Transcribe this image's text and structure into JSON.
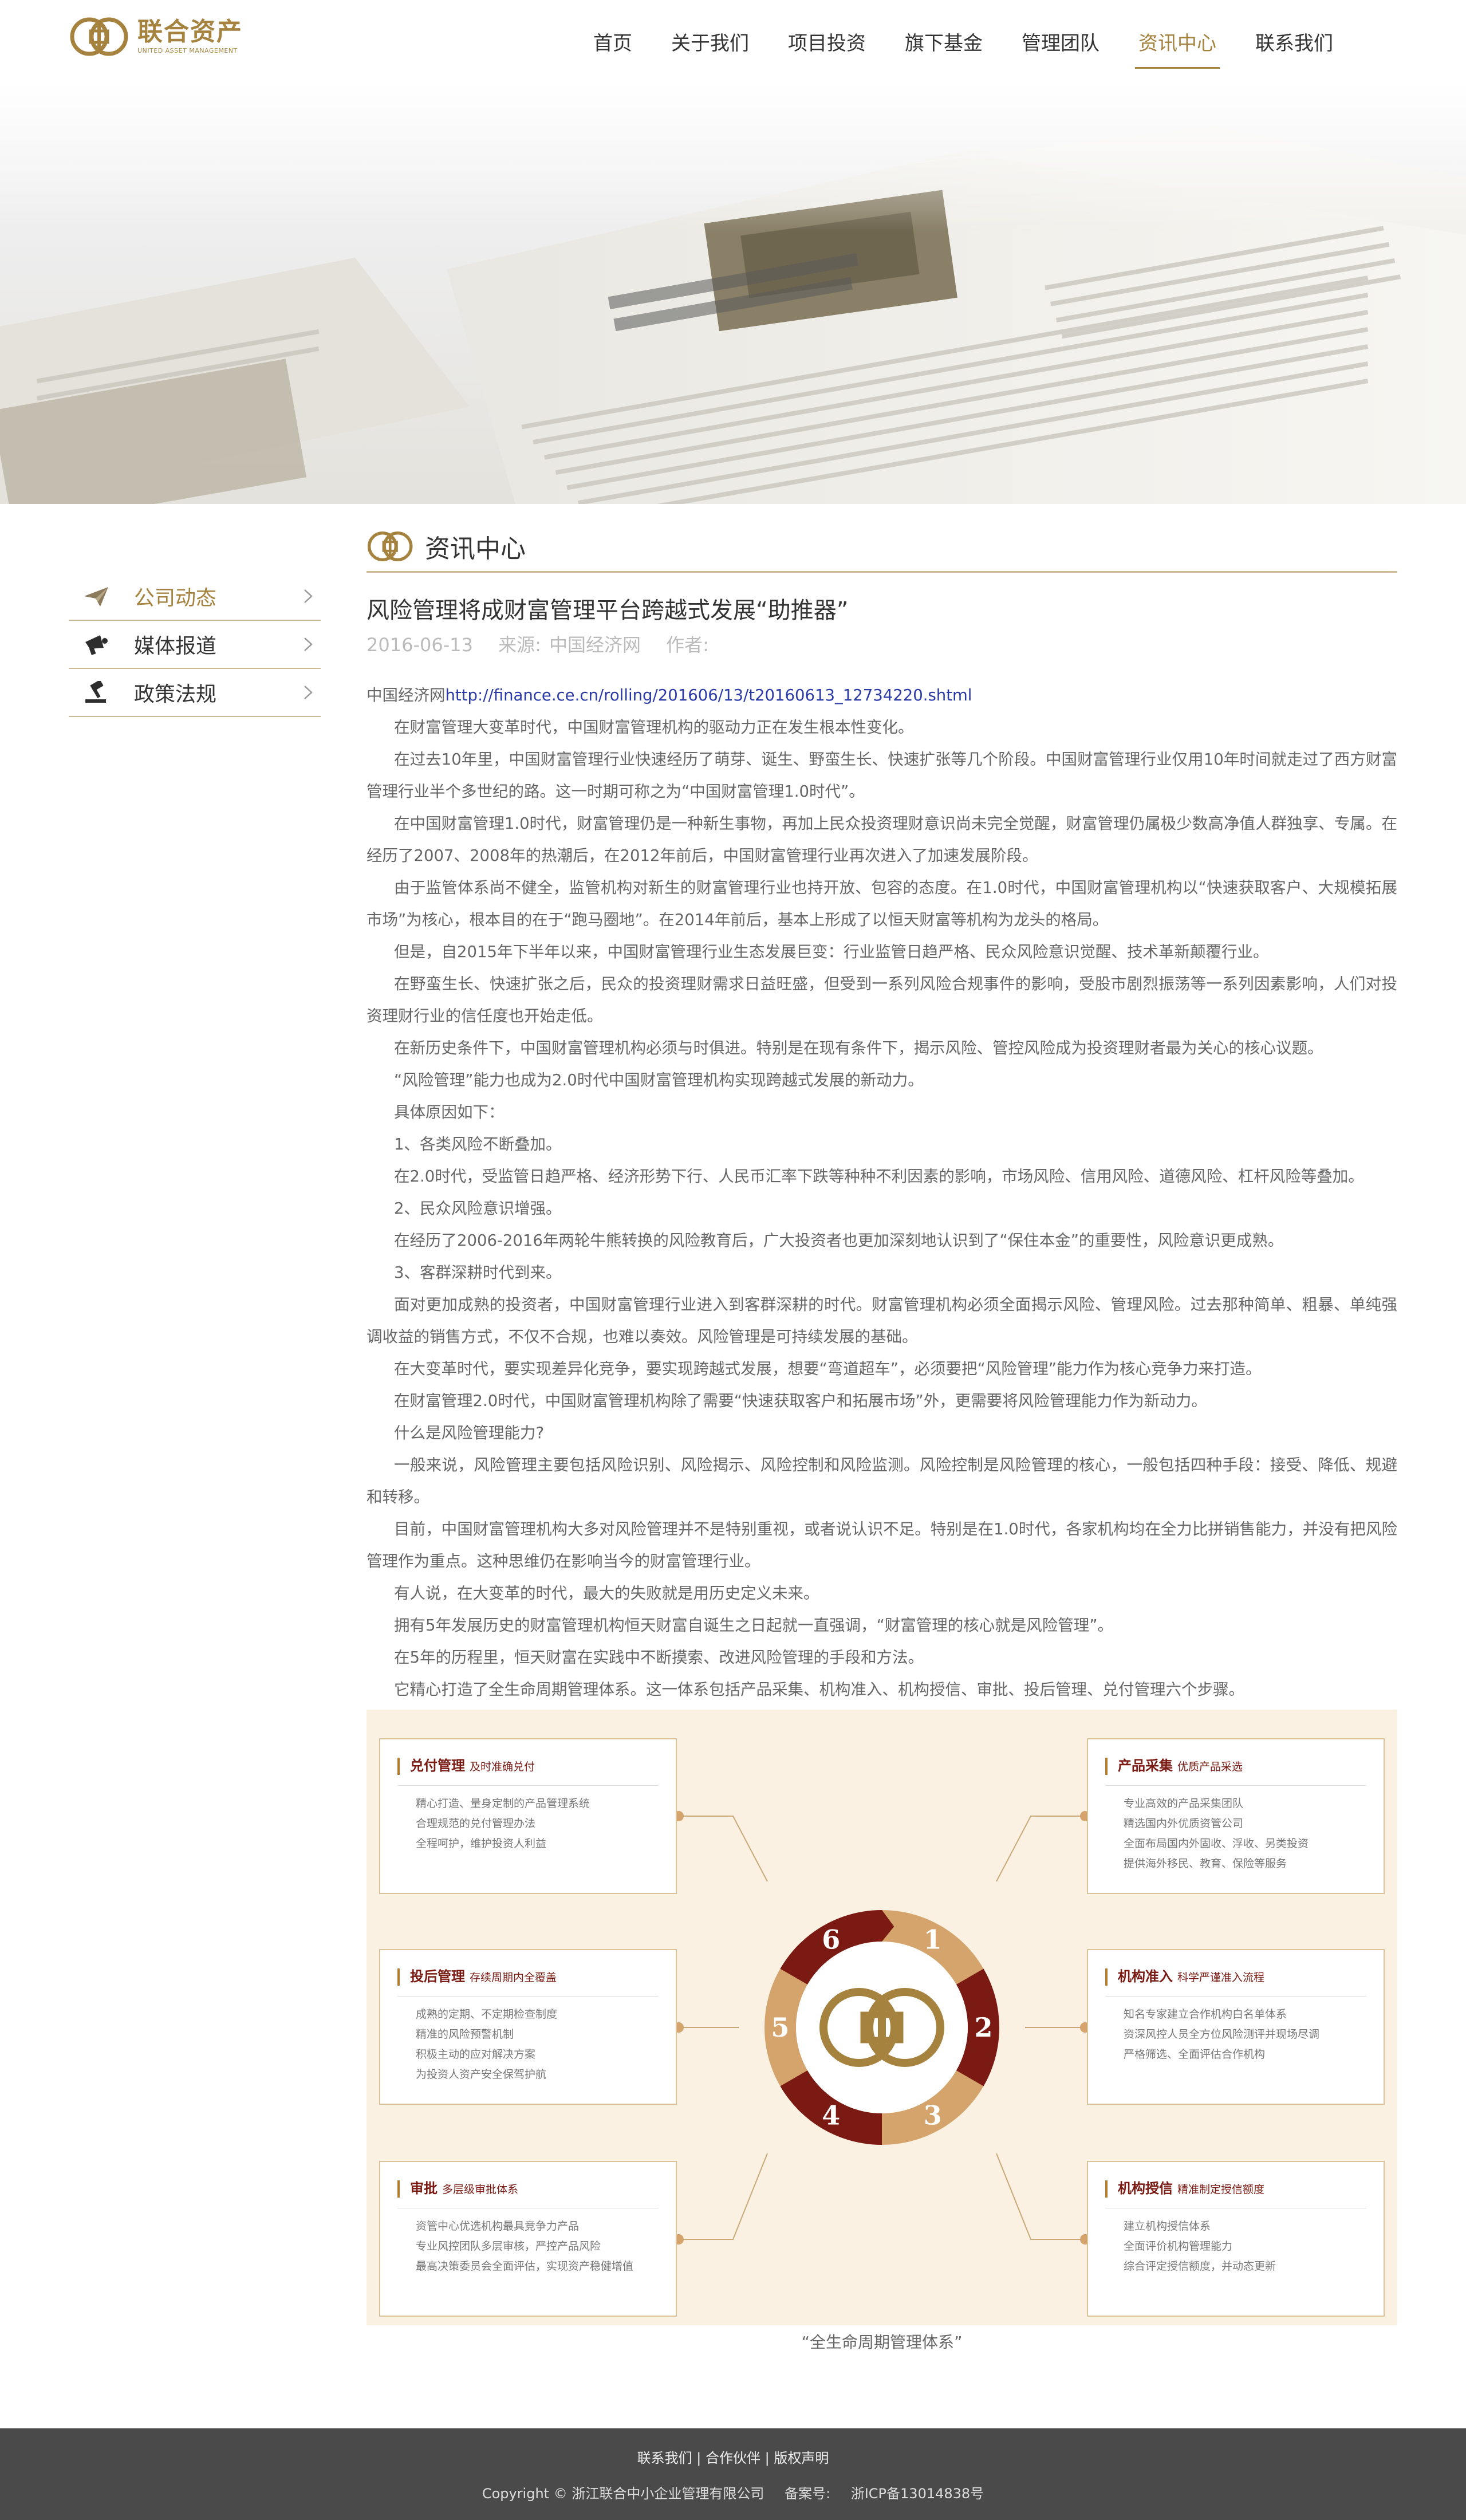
{
  "brand": {
    "name_cn": "联合资产",
    "name_en": "UNITED ASSET MANAGEMENT"
  },
  "nav": [
    {
      "label": "首页"
    },
    {
      "label": "关于我们"
    },
    {
      "label": "项目投资"
    },
    {
      "label": "旗下基金"
    },
    {
      "label": "管理团队"
    },
    {
      "label": "资讯中心"
    },
    {
      "label": "联系我们"
    }
  ],
  "nav_active": "资讯中心",
  "sidebar": {
    "items": [
      {
        "label": "公司动态",
        "icon": "paper-plane-icon",
        "active": true
      },
      {
        "label": "媒体报道",
        "icon": "megaphone-icon",
        "active": false
      },
      {
        "label": "政策法规",
        "icon": "gavel-icon",
        "active": false
      }
    ]
  },
  "section": {
    "title": "资讯中心"
  },
  "article": {
    "title": "风险管理将成财富管理平台跨越式发展“助推器”",
    "date": "2016-06-13",
    "source_label": "来源:",
    "source": "中国经济网",
    "author_label": "作者:",
    "source_prefix": "中国经济网",
    "source_url": "http://finance.ce.cn/rolling/201606/13/t20160613_12734220.shtml",
    "paragraphs": [
      "在财富管理大变革时代，中国财富管理机构的驱动力正在发生根本性变化。",
      "在过去10年里，中国财富管理行业快速经历了萌芽、诞生、野蛮生长、快速扩张等几个阶段。中国财富管理行业仅用10年时间就走过了西方财富管理行业半个多世纪的路。这一时期可称之为“中国财富管理1.0时代”。",
      "在中国财富管理1.0时代，财富管理仍是一种新生事物，再加上民众投资理财意识尚未完全觉醒，财富管理仍属极少数高净值人群独享、专属。在经历了2007、2008年的热潮后，在2012年前后，中国财富管理行业再次进入了加速发展阶段。",
      "由于监管体系尚不健全，监管机构对新生的财富管理行业也持开放、包容的态度。在1.0时代，中国财富管理机构以“快速获取客户、大规模拓展市场”为核心，根本目的在于“跑马圈地”。在2014年前后，基本上形成了以恒天财富等机构为龙头的格局。",
      "但是，自2015年下半年以来，中国财富管理行业生态发展巨变：行业监管日趋严格、民众风险意识觉醒、技术革新颠覆行业。",
      "在野蛮生长、快速扩张之后，民众的投资理财需求日益旺盛，但受到一系列风险合规事件的影响，受股市剧烈振荡等一系列因素影响，人们对投资理财行业的信任度也开始走低。",
      "在新历史条件下，中国财富管理机构必须与时俱进。特别是在现有条件下，揭示风险、管控风险成为投资理财者最为关心的核心议题。",
      "“风险管理”能力也成为2.0时代中国财富管理机构实现跨越式发展的新动力。",
      "具体原因如下：",
      "1、各类风险不断叠加。",
      "在2.0时代，受监管日趋严格、经济形势下行、人民币汇率下跌等种种不利因素的影响，市场风险、信用风险、道德风险、杠杆风险等叠加。",
      "2、民众风险意识增强。",
      "在经历了2006-2016年两轮牛熊转换的风险教育后，广大投资者也更加深刻地认识到了“保住本金”的重要性，风险意识更成熟。",
      "3、客群深耕时代到来。",
      "面对更加成熟的投资者，中国财富管理行业进入到客群深耕的时代。财富管理机构必须全面揭示风险、管理风险。过去那种简单、粗暴、单纯强调收益的销售方式，不仅不合规，也难以奏效。风险管理是可持续发展的基础。",
      "在大变革时代，要实现差异化竞争，要实现跨越式发展，想要“弯道超车”，必须要把“风险管理”能力作为核心竞争力来打造。",
      "在财富管理2.0时代，中国财富管理机构除了需要“快速获取客户和拓展市场”外，更需要将风险管理能力作为新动力。",
      "什么是风险管理能力?",
      "一般来说，风险管理主要包括风险识别、风险揭示、风险控制和风险监测。风险控制是风险管理的核心，一般包括四种手段：接受、降低、规避和转移。",
      "目前，中国财富管理机构大多对风险管理并不是特别重视，或者说认识不足。特别是在1.0时代，各家机构均在全力比拼销售能力，并没有把风险管理作为重点。这种思维仍在影响当今的财富管理行业。",
      "有人说，在大变革的时代，最大的失败就是用历史定义未来。",
      "拥有5年发展历史的财富管理机构恒天财富自诞生之日起就一直强调，“财富管理的核心就是风险管理”。",
      "在5年的历程里，恒天财富在实践中不断摸索、改进风险管理的手段和方法。",
      "它精心打造了全生命周期管理体系。这一体系包括产品采集、机构准入、机构授信、审批、投后管理、兑付管理六个步骤。"
    ]
  },
  "diagram": {
    "colors": {
      "dark": "#7a1a12",
      "light": "#d4a46c",
      "line": "#c9a978",
      "bg": "#faf1e2"
    },
    "center_icon": "coin-logo-icon",
    "steps": [
      "1",
      "2",
      "3",
      "4",
      "5",
      "6"
    ],
    "cards": [
      {
        "title": "兑付管理",
        "subtitle": "及时准确兑付",
        "lines": [
          "精心打造、量身定制的产品管理系统",
          "合理规范的兑付管理办法",
          "全程呵护，维护投资人利益"
        ]
      },
      {
        "title": "产品采集",
        "subtitle": "优质产品采选",
        "lines": [
          "专业高效的产品采集团队",
          "精选国内外优质资管公司",
          "全面布局国内外固收、浮收、另类投资",
          "提供海外移民、教育、保险等服务"
        ]
      },
      {
        "title": "投后管理",
        "subtitle": "存续周期内全覆盖",
        "lines": [
          "成熟的定期、不定期检查制度",
          "精准的风险预警机制",
          "积极主动的应对解决方案",
          "为投资人资产安全保驾护航"
        ]
      },
      {
        "title": "机构准入",
        "subtitle": "科学严谨准入流程",
        "lines": [
          "知名专家建立合作机构白名单体系",
          "资深风控人员全方位风险测评并现场尽调",
          "严格筛选、全面评估合作机构"
        ]
      },
      {
        "title": "审批",
        "subtitle": "多层级审批体系",
        "lines": [
          "资管中心优选机构最具竞争力产品",
          "专业风控团队多层审核，严控产品风险",
          "最高决策委员会全面评估，实现资产稳健增值"
        ]
      },
      {
        "title": "机构授信",
        "subtitle": "精准制定授信额度",
        "lines": [
          "建立机构授信体系",
          "全面评价机构管理能力",
          "综合评定授信额度，并动态更新"
        ]
      }
    ],
    "caption": "“全生命周期管理体系”"
  },
  "footer": {
    "links": [
      "联系我们",
      "合作伙伴",
      "版权声明"
    ],
    "separator": "|",
    "copyright": "Copyright © 浙江联合中小企业管理有限公司",
    "icp_label": "备案号:",
    "icp": "浙ICP备13014838号"
  }
}
